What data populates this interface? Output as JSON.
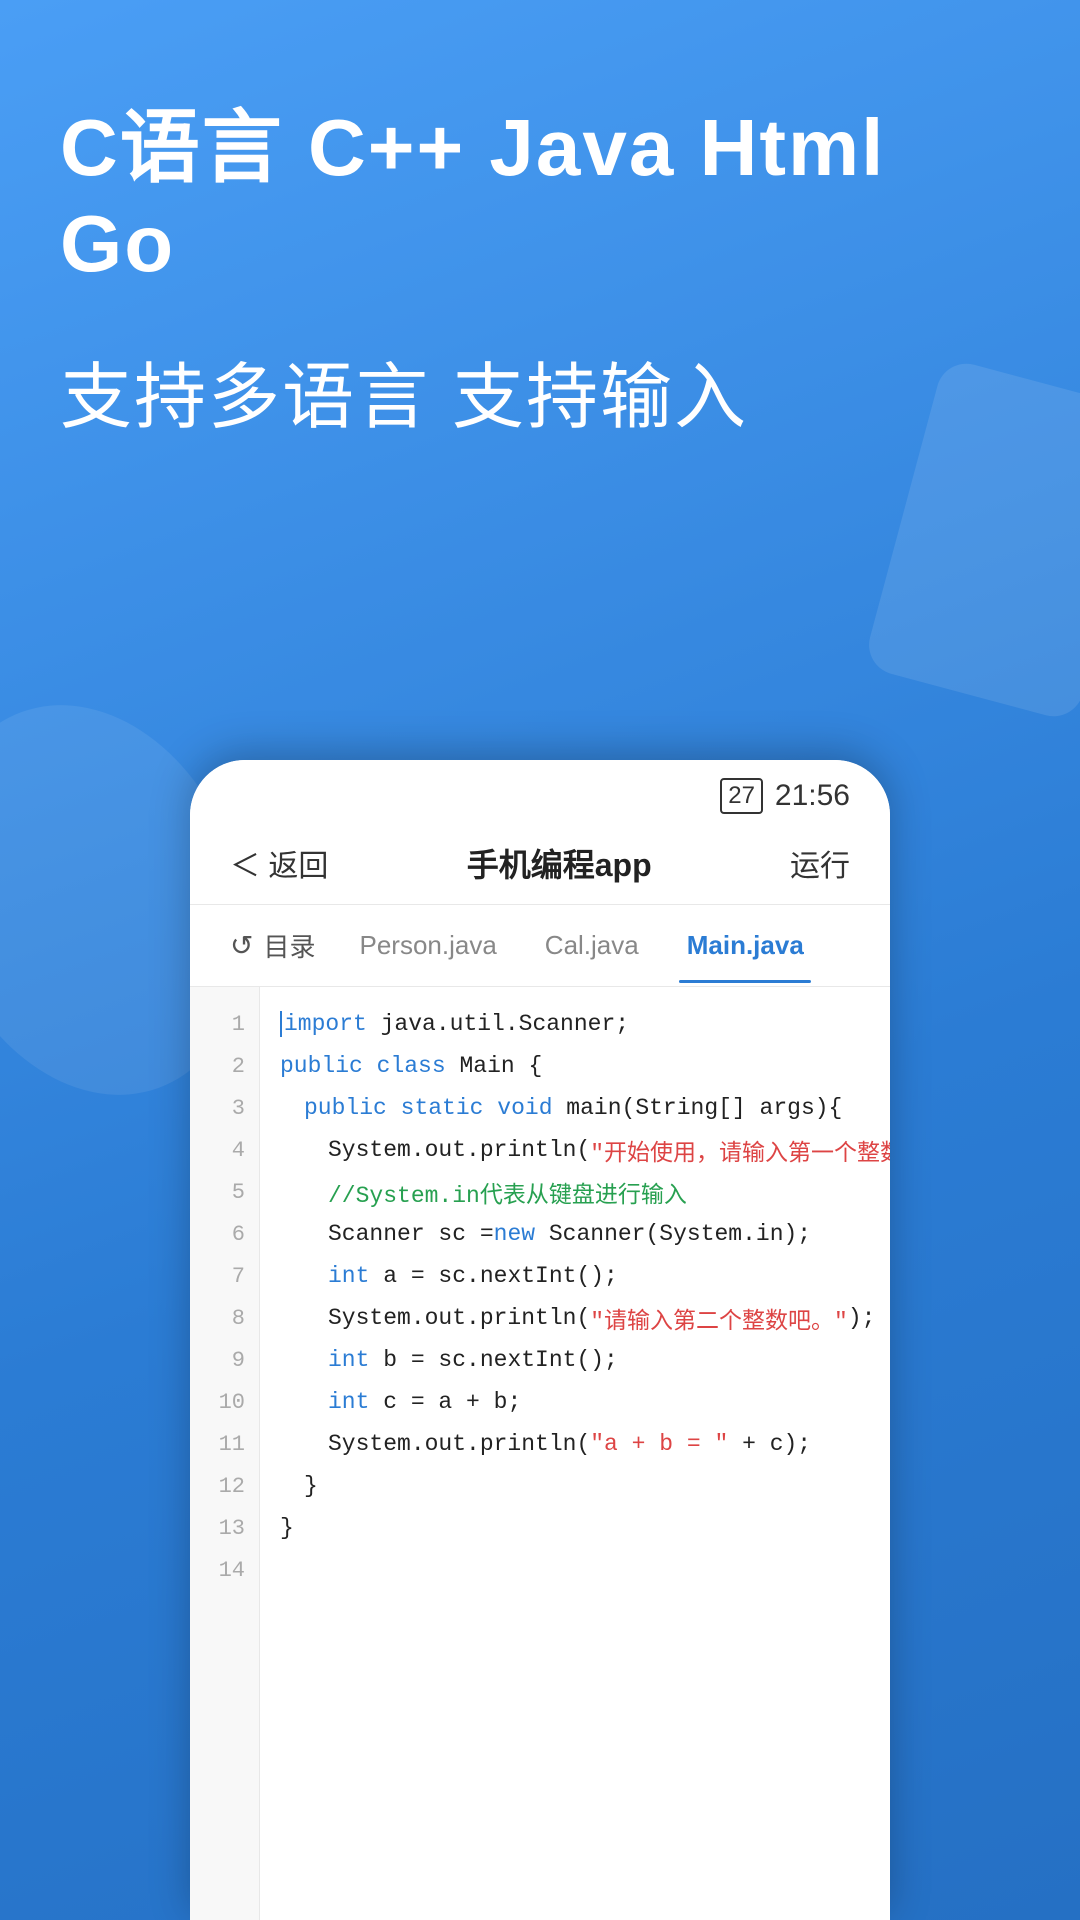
{
  "background": {
    "gradient_start": "#4a9ef5",
    "gradient_end": "#2570c4"
  },
  "hero": {
    "title": "C语言  C++  Java  Html  Go",
    "subtitle": "支持多语言  支持输入"
  },
  "phone": {
    "status_bar": {
      "battery": "27",
      "time": "21:56"
    },
    "header": {
      "back_label": "＜ 返回",
      "title": "手机编程app",
      "run_label": "运行"
    },
    "tabs": [
      {
        "id": "folder",
        "label": "目录",
        "icon": "↺",
        "active": false
      },
      {
        "id": "person",
        "label": "Person.java",
        "active": false
      },
      {
        "id": "cal",
        "label": "Cal.java",
        "active": false
      },
      {
        "id": "main",
        "label": "Main.java",
        "active": true
      }
    ],
    "code": {
      "lines": [
        {
          "num": 1,
          "text": "import java.util.Scanner;"
        },
        {
          "num": 2,
          "text": "public class Main {"
        },
        {
          "num": 3,
          "text": "    public static void main(String[] args){"
        },
        {
          "num": 4,
          "text": "        System.out.println(\"开始使用，请输入第一个整数吧。\");"
        },
        {
          "num": 5,
          "text": "        //System.in代表从键盘进行输入"
        },
        {
          "num": 6,
          "text": "        Scanner sc = new Scanner(System.in);"
        },
        {
          "num": 7,
          "text": "        int a = sc.nextInt();"
        },
        {
          "num": 8,
          "text": "        System.out.println(\"请输入第二个整数吧。\");"
        },
        {
          "num": 9,
          "text": "        int b = sc.nextInt();"
        },
        {
          "num": 10,
          "text": "        int c = a + b;"
        },
        {
          "num": 11,
          "text": "        System.out.println(\"a + b = \" + c);"
        },
        {
          "num": 12,
          "text": "    }"
        },
        {
          "num": 13,
          "text": "}"
        },
        {
          "num": 14,
          "text": ""
        }
      ]
    }
  }
}
